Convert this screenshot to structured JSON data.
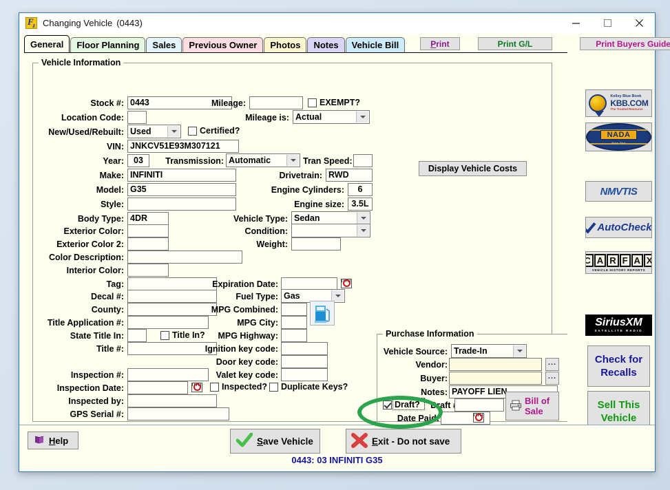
{
  "window": {
    "title": "Changing Vehicle",
    "title_number": "(0443)",
    "app_icon": "frazer-app-icon",
    "minimize": "minimize-icon",
    "maximize": "maximize-icon",
    "close": "close-icon"
  },
  "tabs": [
    {
      "label": "General",
      "color": "#fffff0",
      "active": true
    },
    {
      "label": "Floor Planning",
      "color": "#e4f7e0",
      "active": false
    },
    {
      "label": "Sales",
      "color": "#e3f4fd",
      "active": false
    },
    {
      "label": "Previous Owner",
      "color": "#fbdde2",
      "active": false
    },
    {
      "label": "Photos",
      "color": "#fbf6ce",
      "active": false
    },
    {
      "label": "Notes",
      "color": "#d9d5f5",
      "active": false
    },
    {
      "label": "Vehicle Bill",
      "color": "#ccebfb",
      "active": false
    }
  ],
  "print_buttons": [
    {
      "label": "Print",
      "accel": "P",
      "color": "#8b1a8b"
    },
    {
      "label": "Print G/L",
      "accel": "",
      "color": "#0a7a20"
    },
    {
      "label": "Print Buyers Guide",
      "accel": "",
      "color": "#b3158f"
    }
  ],
  "vehicle_information": {
    "legend": "Vehicle Information",
    "fields": {
      "stock_no": {
        "label": "Stock #:",
        "value": "0443"
      },
      "mileage": {
        "label": "Mileage:",
        "value": ""
      },
      "exempt": {
        "label": "EXEMPT?",
        "checked": false
      },
      "location_code": {
        "label": "Location Code:",
        "value": ""
      },
      "mileage_is": {
        "label": "Mileage is:",
        "value": "Actual"
      },
      "new_used": {
        "label": "New/Used/Rebuilt:",
        "value": "Used"
      },
      "certified": {
        "label": "Certified?",
        "checked": false
      },
      "vin": {
        "label": "VIN:",
        "value": "JNKCV51E93M307121"
      },
      "year": {
        "label": "Year:",
        "value": "03"
      },
      "transmission": {
        "label": "Transmission:",
        "value": "Automatic"
      },
      "tran_speed": {
        "label": "Tran Speed:",
        "value": ""
      },
      "make": {
        "label": "Make:",
        "value": "INFINITI"
      },
      "drivetrain": {
        "label": "Drivetrain:",
        "value": "RWD"
      },
      "model": {
        "label": "Model:",
        "value": "G35"
      },
      "engine_cylinders": {
        "label": "Engine Cylinders:",
        "value": "6"
      },
      "style": {
        "label": "Style:",
        "value": ""
      },
      "engine_size": {
        "label": "Engine size:",
        "value": "3.5L"
      },
      "body_type": {
        "label": "Body Type:",
        "value": "4DR"
      },
      "vehicle_type": {
        "label": "Vehicle Type:",
        "value": "Sedan"
      },
      "exterior_color": {
        "label": "Exterior Color:",
        "value": ""
      },
      "condition": {
        "label": "Condition:",
        "value": ""
      },
      "exterior_color2": {
        "label": "Exterior Color 2:",
        "value": ""
      },
      "weight": {
        "label": "Weight:",
        "value": ""
      },
      "color_desc": {
        "label": "Color Description:",
        "value": ""
      },
      "interior_color": {
        "label": "Interior Color:",
        "value": ""
      },
      "tag": {
        "label": "Tag:",
        "value": ""
      },
      "expiration_date": {
        "label": "Expiration Date:",
        "value": ""
      },
      "decal_no": {
        "label": "Decal #:",
        "value": ""
      },
      "fuel_type": {
        "label": "Fuel Type:",
        "value": "Gas"
      },
      "county": {
        "label": "County:",
        "value": ""
      },
      "mpg_combined": {
        "label": "MPG Combined:",
        "value": ""
      },
      "title_app_no": {
        "label": "Title Application #:",
        "value": ""
      },
      "mpg_city": {
        "label": "MPG City:",
        "value": ""
      },
      "state_title_in": {
        "label": "State Title In:",
        "value": ""
      },
      "title_in": {
        "label": "Title In?",
        "checked": false
      },
      "mpg_highway": {
        "label": "MPG Highway:",
        "value": ""
      },
      "title_no": {
        "label": "Title #:",
        "value": ""
      },
      "ignition_key": {
        "label": "Ignition key code:",
        "value": ""
      },
      "door_key": {
        "label": "Door key code:",
        "value": ""
      },
      "inspection_no": {
        "label": "Inspection #:",
        "value": ""
      },
      "valet_key": {
        "label": "Valet key code:",
        "value": ""
      },
      "inspection_date": {
        "label": "Inspection Date:",
        "value": ""
      },
      "inspected": {
        "label": "Inspected?",
        "checked": false
      },
      "duplicate_keys": {
        "label": "Duplicate Keys?",
        "checked": false
      },
      "inspected_by": {
        "label": "Inspected by:",
        "value": ""
      },
      "gps_serial": {
        "label": "GPS Serial #:",
        "value": ""
      }
    }
  },
  "display_costs_button": {
    "label": "Display Vehicle Costs"
  },
  "purchase_information": {
    "legend": "Purchase Information",
    "vehicle_source": {
      "label": "Vehicle Source:",
      "value": "Trade-In"
    },
    "vendor": {
      "label": "Vendor:",
      "value": "",
      "browse": "..."
    },
    "buyer": {
      "label": "Buyer:",
      "value": "",
      "browse": "..."
    },
    "notes": {
      "label": "Notes:",
      "value": "PAYOFF LIEN"
    },
    "draft": {
      "label": "Draft?",
      "checked": true
    },
    "draft_no": {
      "label": "Draft #:",
      "value": ""
    },
    "date_paid": {
      "label": "Date Paid:",
      "value": ""
    },
    "bill_of_sale": {
      "line1": "Bill of",
      "line2": "Sale",
      "color": "#b3158f"
    }
  },
  "sidebar": {
    "kbb": {
      "name": "KBB.COM",
      "line1": "Kelley Blue Book",
      "line2": "KBB.COM",
      "line3": "The Trusted Resource"
    },
    "nada": {
      "name": "NADA",
      "badge": "NADA",
      "sub": "Blue Pad"
    },
    "nmvtis": {
      "name": "NMVTIS",
      "label": "NMVTIS"
    },
    "autocheck": {
      "name": "AutoCheck",
      "label": "AutoCheck"
    },
    "carfax": {
      "name": "CARFAX",
      "letters": [
        "C",
        "A",
        "R",
        "F",
        "A",
        "X"
      ],
      "sub": "VEHICLE HISTORY REPORTS"
    },
    "siriusxm": {
      "name": "SiriusXM",
      "label": "SiriusXM",
      "sub": "SATELLITE RADIO"
    },
    "recalls": {
      "line1": "Check for",
      "line2": "Recalls",
      "color": "#17179c"
    },
    "sell": {
      "line1": "Sell This",
      "line2": "Vehicle",
      "color": "#0f9b0f"
    }
  },
  "footer": {
    "help": {
      "label": "Help",
      "accel": "H"
    },
    "save": {
      "label": "Save Vehicle",
      "accel": "S"
    },
    "exit": {
      "label": "Exit - Do not save",
      "accel": "E"
    },
    "status": "0443:  03 INFINITI G35"
  },
  "annotation": {
    "shape": "ellipse",
    "color": "#2ca44e",
    "target": "draft-checkbox"
  }
}
